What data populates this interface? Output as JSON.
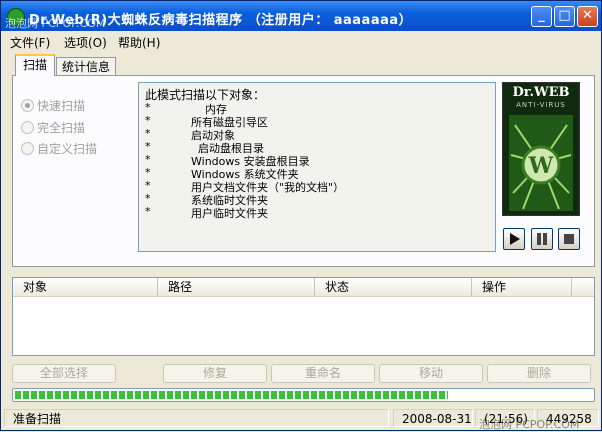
{
  "window": {
    "title": "Dr.Web(R)大蜘蛛反病毒扫描程序 （注册用户： aaaaaaa）",
    "minimize_glyph": "_",
    "maximize_glyph": "□",
    "close_glyph": "✕"
  },
  "menu": [
    {
      "label": "文件(F)"
    },
    {
      "label": "选项(O)"
    },
    {
      "label": "帮助(H)"
    }
  ],
  "tabs": [
    {
      "label": "扫描",
      "active": true
    },
    {
      "label": "统计信息",
      "active": false
    }
  ],
  "scan_modes": [
    {
      "label": "快速扫描",
      "selected": true,
      "enabled": false
    },
    {
      "label": "完全扫描",
      "selected": false,
      "enabled": false
    },
    {
      "label": "自定义扫描",
      "selected": false,
      "enabled": false
    }
  ],
  "info": {
    "header": "此模式扫描以下对象：",
    "items": [
      {
        "star": "*",
        "text": "内存"
      },
      {
        "star": "*",
        "text": "所有磁盘引导区"
      },
      {
        "star": "*",
        "text": "启动对象"
      },
      {
        "star": "*",
        "text": "启动盘根目录"
      },
      {
        "star": "*",
        "text": "Windows 安装盘根目录"
      },
      {
        "star": "*",
        "text": "Windows 系统文件夹"
      },
      {
        "star": "*",
        "text": "用户文档文件夹（\"我的文档\"）"
      },
      {
        "star": "*",
        "text": "系统临时文件夹"
      },
      {
        "star": "*",
        "text": "用户临时文件夹"
      }
    ]
  },
  "logo": {
    "brand": "Dr.WEB",
    "sub": "ANTI-VIRUS"
  },
  "controls": {
    "play_icon": "play-icon",
    "pause_icon": "pause-icon",
    "stop_icon": "stop-icon"
  },
  "table": {
    "columns": [
      "对象",
      "路径",
      "状态",
      "操作"
    ],
    "rows": []
  },
  "actions": [
    {
      "label": "全部选择"
    },
    {
      "label": "修复"
    },
    {
      "label": "重命名"
    },
    {
      "label": "移动"
    },
    {
      "label": "删除"
    }
  ],
  "progress": {
    "value": 0.75
  },
  "status": {
    "text": "准备扫描",
    "date": "2008-08-31",
    "time": "(21:56)",
    "count": "449258"
  },
  "watermarks": {
    "top": "泡泡网 PCPOP.COM",
    "bottom": "泡泡网 PCPOP.COM"
  },
  "colors": {
    "title_bar": "#0a5fdc",
    "progress": "#37c437",
    "tab_highlight": "#ffc83c"
  }
}
